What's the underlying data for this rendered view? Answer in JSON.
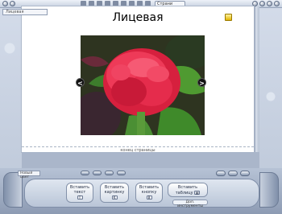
{
  "top_bar": {
    "zoom_label": "Страни"
  },
  "doc_name": "Лицевая",
  "page": {
    "title": "Лицевая",
    "end_of_page_label": "конец страницы"
  },
  "photo": {
    "prev_glyph": "<",
    "next_glyph": ">"
  },
  "bottom": {
    "color_field": "Новый цвет",
    "buttons": [
      {
        "line1": "Вставить",
        "line2": "текст",
        "key": "T"
      },
      {
        "line1": "Вставить",
        "line2": "картинку",
        "key": "K"
      },
      {
        "line1": "Вставить",
        "line2": "кнопку",
        "key": "B"
      },
      {
        "line1": "Вставить",
        "line2": "таблицу",
        "key": "▦"
      }
    ],
    "more_label": "Доп. инструменты"
  },
  "colors": {
    "page": "#ffffff",
    "chrome": "#c7d1e0",
    "flower": "#e62a4a",
    "leaves": "#3f8a2a"
  }
}
